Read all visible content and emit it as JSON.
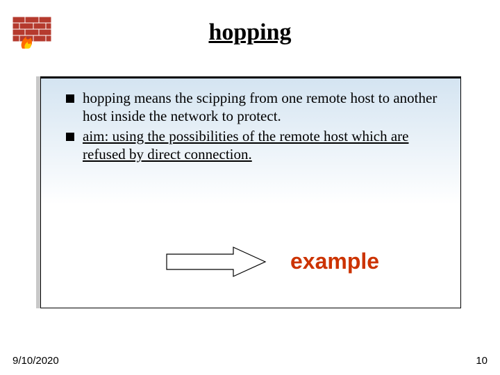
{
  "title": "hopping",
  "bullets": [
    {
      "text": "hopping means the scipping from one remote host to another host inside the network to protect.",
      "underline": false
    },
    {
      "text": "aim: using the possibilities of the remote host which are refused by direct connection.",
      "underline": true
    }
  ],
  "example_label": "example",
  "footer": {
    "date": "9/10/2020",
    "page": "10"
  },
  "icons": {
    "firewall": "firewall-icon",
    "arrow": "right-arrow-icon"
  },
  "colors": {
    "accent": "#cc3300",
    "box_border": "#000000",
    "box_bg_top": "#d4e4f1"
  }
}
